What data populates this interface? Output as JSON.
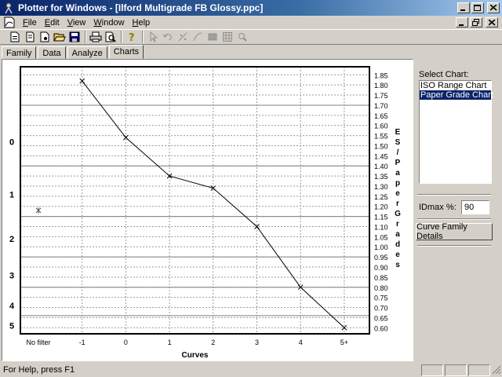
{
  "window": {
    "title": "Plotter for Windows - [Ilford Multigrade FB Glossy.ppc]"
  },
  "menu": [
    {
      "label": "File",
      "ul": "F",
      "rest": "ile"
    },
    {
      "label": "Edit",
      "ul": "E",
      "rest": "dit"
    },
    {
      "label": "View",
      "ul": "V",
      "rest": "iew"
    },
    {
      "label": "Window",
      "ul": "W",
      "rest": "indow"
    },
    {
      "label": "Help",
      "ul": "H",
      "rest": "elp"
    }
  ],
  "toolbar": {
    "buttons": [
      "new-icon",
      "copy-doc-icon",
      "new-doc-icon",
      "open-folder-icon",
      "save-icon",
      "print-icon",
      "print-preview-icon",
      "help-icon",
      "pointer-icon",
      "undo-icon",
      "add-point-icon",
      "draw-curve-icon",
      "fill-icon",
      "grid-icon",
      "zoom-icon"
    ]
  },
  "tabs": [
    {
      "label": "Family",
      "active": false
    },
    {
      "label": "Data",
      "active": false
    },
    {
      "label": "Analyze",
      "active": false
    },
    {
      "label": "Charts",
      "active": true
    }
  ],
  "right_panel": {
    "select_label": "Select Chart:",
    "options": [
      "ISO Range Chart",
      "Paper Grade Chart"
    ],
    "selected_index": 1,
    "idmax_label": "IDmax %:",
    "idmax_value": "90",
    "detail_button": "Curve Family Details"
  },
  "status": {
    "text": "For Help, press F1"
  },
  "chart_data": {
    "type": "line",
    "xlabel": "Curves",
    "ylabel_right": "ES / Paper Grades",
    "categories": [
      "No filter",
      "-1",
      "0",
      "1",
      "2",
      "3",
      "4",
      "5+"
    ],
    "series": [
      {
        "values": [
          null,
          1.82,
          1.54,
          1.35,
          1.29,
          1.1,
          0.8,
          0.6
        ]
      }
    ],
    "isolated_points": [
      {
        "category": "No filter",
        "y": 1.18
      }
    ],
    "y_right_ticks": [
      1.85,
      1.8,
      1.75,
      1.7,
      1.65,
      1.6,
      1.55,
      1.5,
      1.45,
      1.4,
      1.35,
      1.3,
      1.25,
      1.2,
      1.15,
      1.1,
      1.05,
      1.0,
      0.95,
      0.9,
      0.85,
      0.8,
      0.75,
      0.7,
      0.65,
      0.6
    ],
    "ylim": [
      0.57,
      1.89
    ],
    "grade_labels": [
      {
        "label": "0",
        "y": 1.52
      },
      {
        "label": "1",
        "y": 1.26
      },
      {
        "label": "2",
        "y": 1.04
      },
      {
        "label": "3",
        "y": 0.86
      },
      {
        "label": "4",
        "y": 0.71
      },
      {
        "label": "5",
        "y": 0.61
      }
    ],
    "grade_boundaries": [
      1.7,
      1.4,
      1.15,
      0.95,
      0.8,
      0.66
    ],
    "grid": true,
    "colors": {
      "line": "#000000",
      "grid_dashed": "#9a9a9a",
      "grid_solid": "#808080"
    }
  }
}
